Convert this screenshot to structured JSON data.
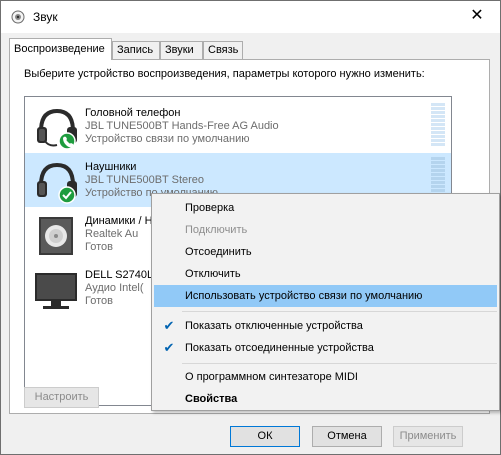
{
  "window": {
    "title": "Звук",
    "close_glyph": "✕"
  },
  "tabs": [
    {
      "label": "Воспроизведение",
      "active": true
    },
    {
      "label": "Запись",
      "active": false
    },
    {
      "label": "Звуки",
      "active": false
    },
    {
      "label": "Связь",
      "active": false
    }
  ],
  "instruction": "Выберите устройство воспроизведения, параметры которого нужно изменить:",
  "devices": [
    {
      "name": "Головной телефон",
      "description": "JBL TUNE500BT Hands-Free AG Audio",
      "status": "Устройство связи по умолчанию",
      "icon": "headset-icon",
      "badge": "phone-badge-icon",
      "selected": false
    },
    {
      "name": "Наушники",
      "description": "JBL TUNE500BT Stereo",
      "status": "Устройство по умолчанию",
      "icon": "headphones-icon",
      "badge": "check-badge-icon",
      "selected": true
    },
    {
      "name": "Динамики / Н",
      "description": "Realtek Au",
      "status": "Готов",
      "icon": "speaker-icon",
      "badge": "",
      "selected": false
    },
    {
      "name": "DELL S2740L",
      "description": "Аудио Intel(",
      "status": "Готов",
      "icon": "monitor-icon",
      "badge": "",
      "selected": false
    }
  ],
  "buttons": {
    "configure": "Настроить",
    "ok": "ОК",
    "cancel": "Отмена",
    "apply": "Применить"
  },
  "context_menu": {
    "items": [
      {
        "label": "Проверка",
        "disabled": false,
        "checked": false,
        "bold": false,
        "highlighted": false
      },
      {
        "label": "Подключить",
        "disabled": true,
        "checked": false,
        "bold": false,
        "highlighted": false
      },
      {
        "label": "Отсоединить",
        "disabled": false,
        "checked": false,
        "bold": false,
        "highlighted": false
      },
      {
        "label": "Отключить",
        "disabled": false,
        "checked": false,
        "bold": false,
        "highlighted": false
      },
      {
        "label": "Использовать устройство связи по умолчанию",
        "disabled": false,
        "checked": false,
        "bold": false,
        "highlighted": true
      },
      {
        "label": "Показать отключенные устройства",
        "disabled": false,
        "checked": true,
        "bold": false,
        "highlighted": false
      },
      {
        "label": "Показать отсоединенные устройства",
        "disabled": false,
        "checked": true,
        "bold": false,
        "highlighted": false
      },
      {
        "label": "О программном синтезаторе MIDI",
        "disabled": false,
        "checked": false,
        "bold": false,
        "highlighted": false
      },
      {
        "label": "Свойства",
        "disabled": false,
        "checked": false,
        "bold": true,
        "highlighted": false
      }
    ],
    "check_glyph": "✔"
  },
  "colors": {
    "selection": "#cce8ff",
    "menu_highlight": "#91c9f7",
    "accent": "#0078d7",
    "badge_green": "#1e9c3e"
  }
}
